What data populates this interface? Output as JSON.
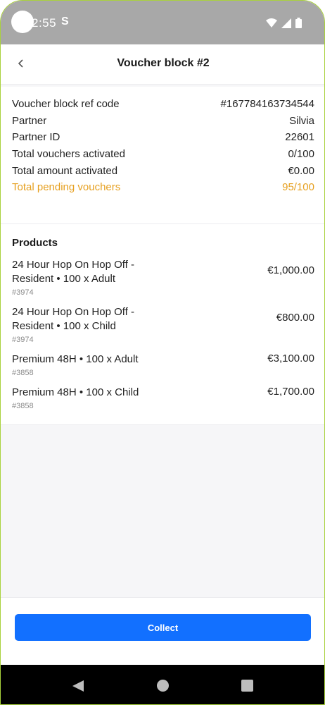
{
  "status_bar": {
    "time": "2:55",
    "indicator": "S"
  },
  "header": {
    "title": "Voucher block #2",
    "back_icon": "chevron-left-icon"
  },
  "details": [
    {
      "label": "Voucher block ref code",
      "value": "#167784163734544"
    },
    {
      "label": "Partner",
      "value": "Silvia"
    },
    {
      "label": "Partner ID",
      "value": "22601"
    },
    {
      "label": "Total vouchers activated",
      "value": "0/100"
    },
    {
      "label": "Total amount activated",
      "value": "€0.00"
    },
    {
      "label": "Total pending vouchers",
      "value": "95/100"
    }
  ],
  "products": {
    "title": "Products",
    "items": [
      {
        "name": "24 Hour Hop On Hop Off - Resident • 100 x Adult",
        "id": "#3974",
        "price": "€1,000.00"
      },
      {
        "name": "24 Hour Hop On Hop Off - Resident • 100 x Child",
        "id": "#3974",
        "price": "€800.00"
      },
      {
        "name": "Premium 48H • 100 x Adult",
        "id": "#3858",
        "price": "€3,100.00"
      },
      {
        "name": "Premium 48H • 100 x Child",
        "id": "#3858",
        "price": "€1,700.00"
      }
    ]
  },
  "actions": {
    "collect_label": "Collect"
  },
  "colors": {
    "accent": "#1270ff",
    "pending": "#e6a020"
  }
}
